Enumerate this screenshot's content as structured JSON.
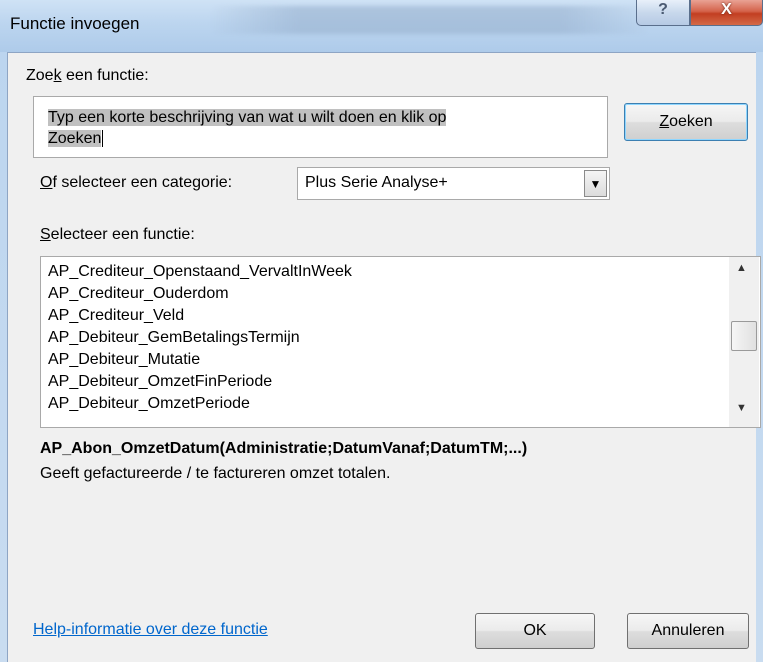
{
  "window": {
    "title": "Functie invoegen",
    "help_glyph": "?",
    "close_glyph": "X"
  },
  "search": {
    "label": "Zoek een functie:",
    "label_parts": {
      "before": "Zoe",
      "mnemonic": "k",
      "after": " een functie:"
    },
    "value_line1": "Typ een korte beschrijving van wat u wilt doen en klik op",
    "value_line2": "Zoeken",
    "button_label": "Zoeken",
    "button_parts": {
      "mnemonic": "Z",
      "after": "oeken"
    }
  },
  "category": {
    "label": "Of selecteer een categorie:",
    "label_parts": {
      "mnemonic": "O",
      "after": "f selecteer een categorie:"
    },
    "selected": "Plus Serie Analyse+",
    "arrow_glyph": "▼"
  },
  "functions": {
    "label": "Selecteer een functie:",
    "label_parts": {
      "mnemonic": "S",
      "after": "electeer een functie:"
    },
    "items": [
      "AP_Crediteur_Openstaand_VervaltInWeek",
      "AP_Crediteur_Ouderdom",
      "AP_Crediteur_Veld",
      "AP_Debiteur_GemBetalingsTermijn",
      "AP_Debiteur_Mutatie",
      "AP_Debiteur_OmzetFinPeriode",
      "AP_Debiteur_OmzetPeriode"
    ],
    "scroll_up_glyph": "▲",
    "scroll_down_glyph": "▼"
  },
  "details": {
    "syntax": "AP_Abon_OmzetDatum(Administratie;DatumVanaf;DatumTM;...)",
    "description": "Geeft gefactureerde / te factureren omzet totalen."
  },
  "footer": {
    "help_link": "Help-informatie over deze functie",
    "ok_label": "OK",
    "cancel_label": "Annuleren"
  }
}
